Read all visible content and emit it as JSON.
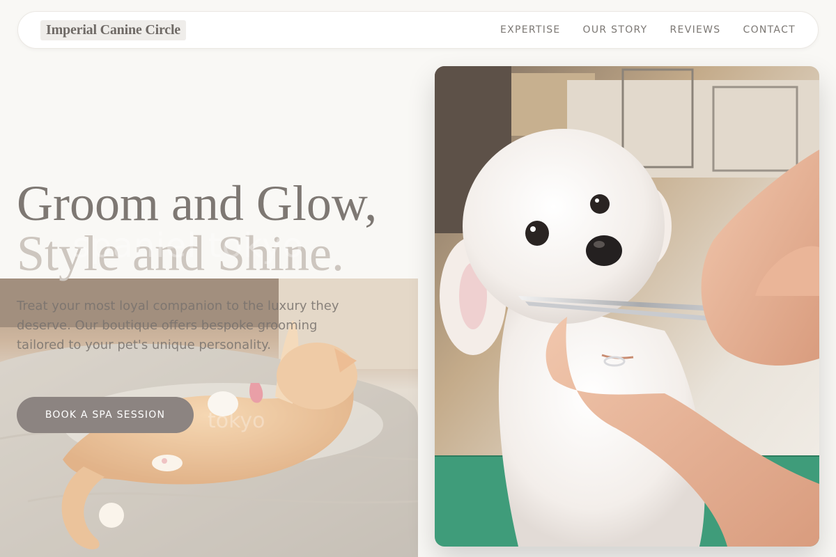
{
  "nav": {
    "brand": "Imperial Canine Circle",
    "links": [
      "EXPERTISE",
      "OUR STORY",
      "REVIEWS",
      "CONTACT"
    ]
  },
  "hero": {
    "title_line1": "Groom and Glow,",
    "title_line2": "Style and Shine.",
    "description": "Treat your most loyal companion to the luxury they deserve. Our boutique offers bespoke grooming tailored to your pet's unique personality.",
    "cta_label": "BOOK A SPA SESSION"
  },
  "photos": {
    "cat_alt": "orange cat lounging on a cushion",
    "dog_alt": "white poodle being groomed with scissors",
    "watermark_small": "tokyo",
    "watermark_large": "spaniel tokyo"
  },
  "colors": {
    "background": "#f9f8f5",
    "title_primary": "#7e7873",
    "title_secondary": "#cdc6bf",
    "cta": "#8c8481",
    "nav_text": "#7c7874"
  }
}
